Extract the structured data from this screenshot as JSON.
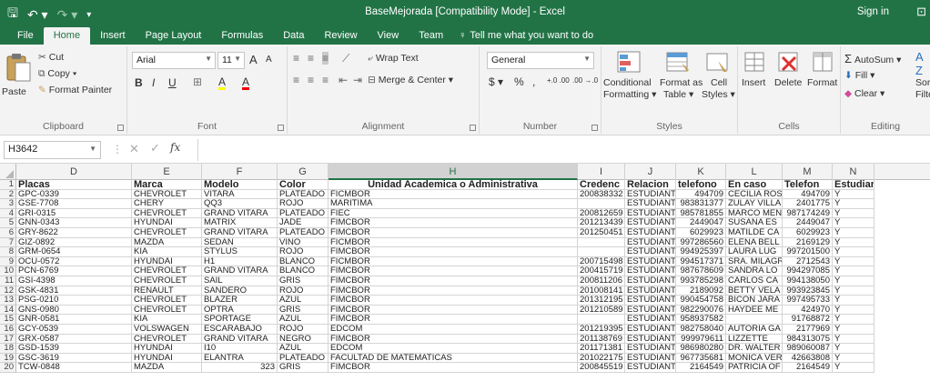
{
  "window": {
    "title": "BaseMejorada  [Compatibility Mode]  -  Excel",
    "sign_in": "Sign in",
    "qa_save": "🖫",
    "qa_undo": "↶ ▾",
    "qa_redo": "↷ ▾",
    "qa_custom": "▾",
    "ribbon_toggle": "⊡"
  },
  "tabs": [
    "File",
    "Home",
    "Insert",
    "Page Layout",
    "Formulas",
    "Data",
    "Review",
    "View",
    "Team"
  ],
  "tell_me": {
    "icon": "lightbulb-icon",
    "text": "Tell me what you want to do",
    "glyph": "♀"
  },
  "ribbon": {
    "clipboard": {
      "paste": "Paste",
      "cut": "Cut",
      "copy": "Copy ▾",
      "format_painter": "Format Painter",
      "label": "Clipboard"
    },
    "font": {
      "name": "Arial",
      "size": "11",
      "grow": "A",
      "shrink": "A",
      "bold": "B",
      "italic": "I",
      "underline": "U",
      "borders": "⊞",
      "fill": "A",
      "color": "A",
      "label": "Font"
    },
    "alignment": {
      "wrap": "Wrap Text",
      "merge": "Merge & Center",
      "label": "Alignment"
    },
    "number": {
      "format": "General",
      "currency": "$",
      "percent": "%",
      "comma": ",",
      "inc": "+.0 .00",
      "dec": ".00 →.0",
      "label": "Number"
    },
    "styles": {
      "conditional": "Conditional",
      "conditional2": "Formatting ▾",
      "format_table": "Format as",
      "format_table2": "Table ▾",
      "cell_styles": "Cell",
      "cell_styles2": "Styles ▾",
      "label": "Styles"
    },
    "cells": {
      "insert": "Insert",
      "delete": "Delete",
      "format": "Format",
      "label": "Cells"
    },
    "editing": {
      "autosum": "AutoSum",
      "fill": "Fill ▾",
      "clear": "Clear ▾",
      "sort": "Sort &",
      "filter": "Filter",
      "label": "Editing"
    }
  },
  "formula_bar": {
    "name_box": "H3642",
    "fx": "fx",
    "value": ""
  },
  "columns": [
    "D",
    "E",
    "F",
    "G",
    "H",
    "I",
    "J",
    "K",
    "L",
    "M",
    "N"
  ],
  "selected_column": "H",
  "header_row": [
    "Placas",
    "Marca",
    "Modelo",
    "Color",
    "Unidad Academica o Administrativa",
    "Credenc",
    "Relacion",
    "telefono",
    "En caso",
    "Telefon",
    "Estudian"
  ],
  "rows": [
    [
      "GPC-0339",
      "CHEVROLET",
      "VITARA",
      "PLATEADO",
      "FICMBOR",
      "200838332",
      "ESTUDIANTI",
      "494709",
      "CECILIA ROS",
      "494709",
      "Y"
    ],
    [
      "GSE-7708",
      "CHERY",
      "QQ3",
      "ROJO",
      "MARITIMA",
      "",
      "ESTUDIANTI",
      "983831377",
      "ZULAY VILLA",
      "2401775",
      "Y"
    ],
    [
      "GRI-0315",
      "CHEVROLET",
      "GRAND VITARA",
      "PLATEADO",
      "FIEC",
      "200812659",
      "ESTUDIANTI",
      "985781855",
      "MARCO MEN",
      "987174249",
      "Y"
    ],
    [
      "GNN-0343",
      "HYUNDAI",
      "MATRIX",
      "JADE",
      "FIMCBOR",
      "201213439",
      "ESTUDIANTI",
      "2449047",
      "SUSANA ES",
      "2449047",
      "Y"
    ],
    [
      "GRY-8622",
      "CHEVROLET",
      "GRAND VITARA",
      "PLATEADO",
      "FIMCBOR",
      "201250451",
      "ESTUDIANTI",
      "6029923",
      "MATILDE CA",
      "6029923",
      "Y"
    ],
    [
      "GIZ-0892",
      "MAZDA",
      "SEDAN",
      "VINO",
      "FICMBOR",
      "",
      "ESTUDIANTI",
      "997286560",
      "ELENA BELL",
      "2169129",
      "Y"
    ],
    [
      "GRM-0654",
      "KIA",
      "STYLUS",
      "ROJO",
      "FIMCBOR",
      "",
      "ESTUDIANTI",
      "994925397",
      "LAURA LUG",
      "997201500",
      "Y"
    ],
    [
      "OCU-0572",
      "HYUNDAI",
      "H1",
      "BLANCO",
      "FICMBOR",
      "200715498",
      "ESTUDIANTI",
      "994517371",
      "SRA. MILAGR",
      "2712543",
      "Y"
    ],
    [
      "PCN-6769",
      "CHEVROLET",
      "GRAND VITARA",
      "BLANCO",
      "FIMCBOR",
      "200415719",
      "ESTUDIANTI",
      "987678609",
      "SANDRA LO",
      "994297085",
      "Y"
    ],
    [
      "GSI-4398",
      "CHEVROLET",
      "SAIL",
      "GRIS",
      "FIMCBOR",
      "200811206",
      "ESTUDIANTI",
      "993785298",
      "CARLOS CA",
      "994138050",
      "Y"
    ],
    [
      "GSK-4831",
      "RENAULT",
      "SANDERO",
      "ROJO",
      "FIMCBOR",
      "201008141",
      "ESTUDIANTI",
      "2189092",
      "BETTY VELA",
      "993923845",
      "Y"
    ],
    [
      "PSG-0210",
      "CHEVROLET",
      "BLAZER",
      "AZUL",
      "FIMCBOR",
      "201312195",
      "ESTUDIANTI",
      "990454758",
      "BICON JARA",
      "997495733",
      "Y"
    ],
    [
      "GNS-0980",
      "CHEVROLET",
      "OPTRA",
      "GRIS",
      "FIMCBOR",
      "201210589",
      "ESTUDIANTI",
      "982290076",
      "HAYDEE ME",
      "424970",
      "Y"
    ],
    [
      "GNR-0581",
      "KIA",
      "SPORTAGE",
      "AZUL",
      "FIMCBOR",
      "",
      "ESTUDIANTI",
      "958937582",
      "",
      "91768872",
      "Y"
    ],
    [
      "GCY-0539",
      "VOLSWAGEN",
      "ESCARABAJO",
      "ROJO",
      "EDCOM",
      "201219395",
      "ESTUDIANTI",
      "982758040",
      "AUTORIA GA",
      "2177969",
      "Y"
    ],
    [
      "GRX-0587",
      "CHEVROLET",
      "GRAND VITARA",
      "NEGRO",
      "FIMCBOR",
      "201138769",
      "ESTUDIANTI",
      "999979611",
      "LIZZETTE",
      "984313075",
      "Y"
    ],
    [
      "GSD-1539",
      "HYUNDAI",
      "I10",
      "AZUL",
      "EDCOM",
      "201171381",
      "ESTUDIANTI",
      "986980280",
      "DR. WALTER",
      "989060087",
      "Y"
    ],
    [
      "GSC-3619",
      "HYUNDAI",
      "ELANTRA",
      "PLATEADO",
      "FACULTAD DE MATEMATICAS",
      "201022175",
      "ESTUDIANTI",
      "967735681",
      "MONICA VER",
      "42663808",
      "Y"
    ],
    [
      "TCW-0848",
      "MAZDA",
      "323",
      "GRIS",
      "FIMCBOR",
      "200845519",
      "ESTUDIANTI",
      "2164549",
      "PATRICIA OF",
      "2164549",
      "Y"
    ]
  ],
  "row_numbers": [
    "1",
    "2",
    "3",
    "4",
    "5",
    "6",
    "7",
    "8",
    "9",
    "10",
    "11",
    "12",
    "13",
    "14",
    "15",
    "16",
    "17",
    "18",
    "19",
    "20"
  ],
  "colors": {
    "brand": "#217346",
    "ribbon_bg": "#f3f3f3"
  }
}
